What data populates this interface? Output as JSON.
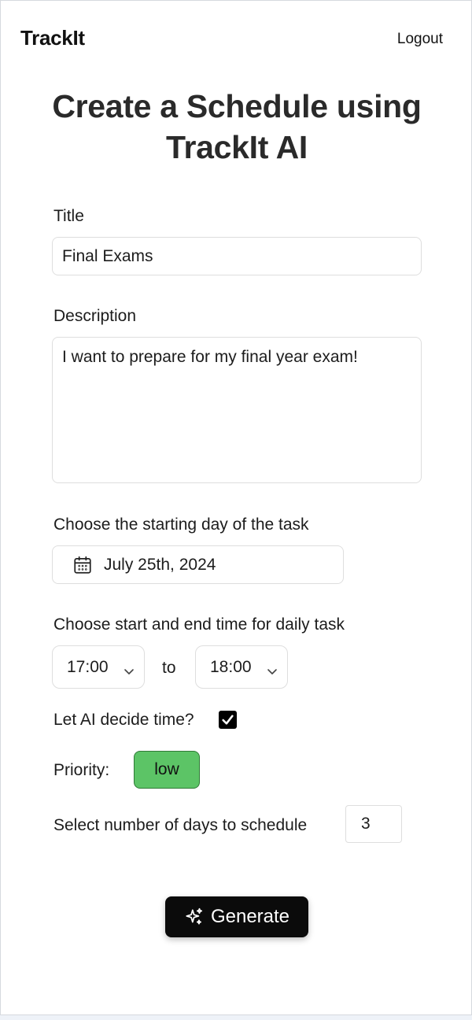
{
  "header": {
    "brand": "TrackIt",
    "logout_label": "Logout"
  },
  "page": {
    "title": "Create a Schedule using TrackIt AI"
  },
  "form": {
    "title_label": "Title",
    "title_value": "Final Exams",
    "description_label": "Description",
    "description_value": "I want to prepare for my final year exam!",
    "start_day_label": "Choose the starting day of the task",
    "start_day_value": "July 25th, 2024",
    "time_label": "Choose start and end time for daily task",
    "start_time": "17:00",
    "to_label": "to",
    "end_time": "18:00",
    "ai_decide_label": "Let AI decide time?",
    "ai_decide_checked": true,
    "priority_label": "Priority:",
    "priority_value": "low",
    "days_label": "Select number of days to schedule",
    "days_value": "3",
    "generate_label": "Generate"
  },
  "icons": {
    "calendar": "calendar-icon",
    "chevron": "chevron-down-icon",
    "checkmark": "checkmark-icon",
    "sparkles": "sparkles-icon"
  },
  "colors": {
    "priority_low_bg": "#5cc466",
    "priority_low_border": "#2f7a36",
    "primary_button": "#0b0b0b"
  }
}
